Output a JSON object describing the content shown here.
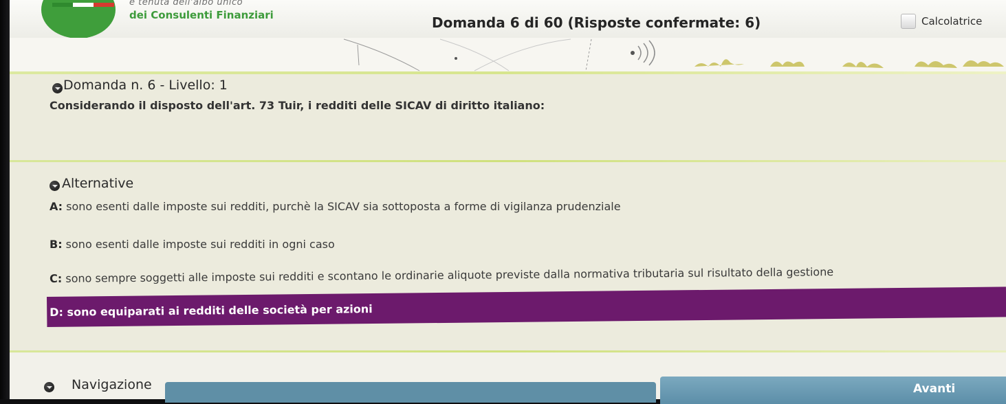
{
  "header": {
    "logo_line1": "e tenuta dell'albo unico",
    "logo_line2": "dei Consulenti Finanziari",
    "title": "Domanda 6 di 60 (Risposte confermate: 6)",
    "calculator_label": "Calcolatrice"
  },
  "question": {
    "heading": "Domanda n. 6 - Livello: 1",
    "text": "Considerando il disposto dell'art. 73 Tuir, i redditi delle SICAV di diritto italiano:"
  },
  "alternatives": {
    "heading": "Alternative",
    "options": [
      {
        "letter": "A:",
        "text": " sono esenti dalle imposte sui redditi, purchè la SICAV sia sottoposta a forme di vigilanza prudenziale"
      },
      {
        "letter": "B:",
        "text": " sono esenti dalle imposte sui redditi in ogni caso"
      },
      {
        "letter": "C:",
        "text": " sono sempre soggetti alle imposte sui redditi e scontano le ordinarie aliquote previste dalla normativa tributaria sul risultato della gestione"
      },
      {
        "letter": "D:",
        "text": " sono equiparati ai redditi delle società per azioni"
      }
    ],
    "selected_letter": "D"
  },
  "navigation": {
    "heading": "Navigazione",
    "next_label": "Avanti"
  },
  "colors": {
    "selected_bg": "#6c1a6c",
    "accent_green": "#3d9b3b",
    "nav_button": "#5f8fa6"
  }
}
